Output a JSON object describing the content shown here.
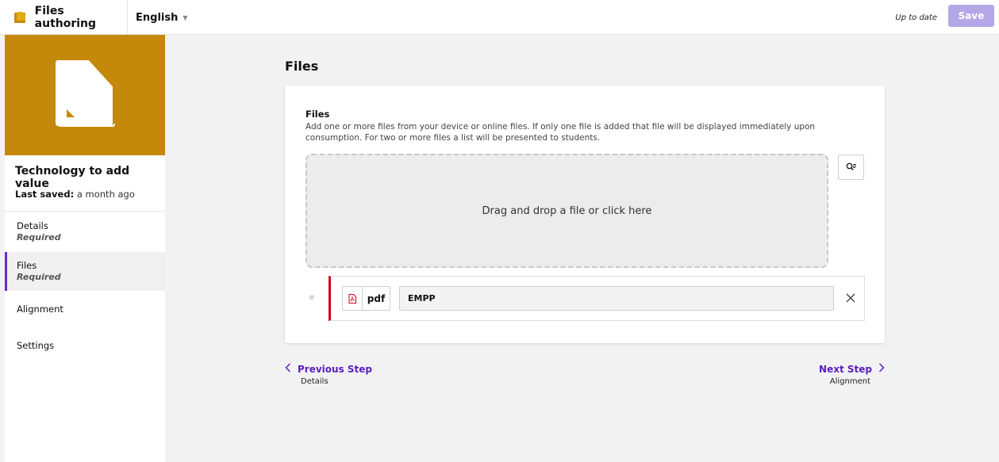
{
  "app": {
    "title": "Files authoring",
    "language": "English"
  },
  "header": {
    "status": "Up to date",
    "save_label": "Save"
  },
  "sidebar": {
    "course_title": "Technology to add value",
    "last_saved_label": "Last saved:",
    "last_saved_value": "a month ago",
    "items": [
      {
        "label": "Details",
        "sub": "Required",
        "active": false
      },
      {
        "label": "Files",
        "sub": "Required",
        "active": true
      },
      {
        "label": "Alignment",
        "sub": "",
        "active": false
      },
      {
        "label": "Settings",
        "sub": "",
        "active": false
      }
    ]
  },
  "main": {
    "page_title": "Files",
    "field_label": "Files",
    "field_description": "Add one or more files from your device or online files. If only one file is added that file will be displayed immediately upon consumption. For two or more files a list will be presented to students.",
    "dropzone_text": "Drag and drop a file or click here",
    "files": [
      {
        "type": "pdf",
        "name": "EMPP"
      }
    ]
  },
  "navigation": {
    "prev_label": "Previous Step",
    "prev_target": "Details",
    "next_label": "Next Step",
    "next_target": "Alignment"
  },
  "colors": {
    "accent": "#5a1fbd",
    "thumbnail": "#c4880a",
    "save_button": "#b4a7e8",
    "file_marker": "#d0021b"
  }
}
